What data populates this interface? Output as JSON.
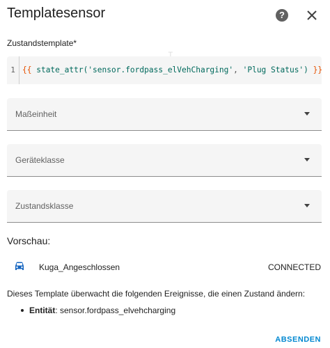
{
  "dialog": {
    "title": "Templatesensor"
  },
  "header": {
    "help_icon": "help-circle-icon",
    "close_icon": "close-icon"
  },
  "state_template": {
    "label": "Zustandstemplate*",
    "line_number": "1",
    "tokens": {
      "open": "{{",
      "fn": " state_attr(",
      "arg1": "'sensor.fordpass_elVehCharging'",
      "comma": ", ",
      "arg2": "'Plug Status'",
      "paren": ")",
      "close": " }}"
    }
  },
  "fields": {
    "unit": {
      "label": "Maßeinheit"
    },
    "device_class": {
      "label": "Geräteklasse"
    },
    "state_class": {
      "label": "Zustandsklasse"
    }
  },
  "preview": {
    "heading": "Vorschau:",
    "entity_icon": "car-icon",
    "entity_name": "Kuga_Angeschlossen",
    "entity_state": "CONNECTED",
    "monitor_text": "Dieses Template überwacht die folgenden Ereignisse, die einen Zustand ändern:",
    "listeners": [
      {
        "label": "Entität",
        "value": ": sensor.fordpass_elvehcharging"
      }
    ]
  },
  "actions": {
    "submit_label": "ABSENDEN"
  },
  "colors": {
    "accent": "#0288d1",
    "car_icon": "#1565c0",
    "field_bg": "#f5f5f5"
  }
}
